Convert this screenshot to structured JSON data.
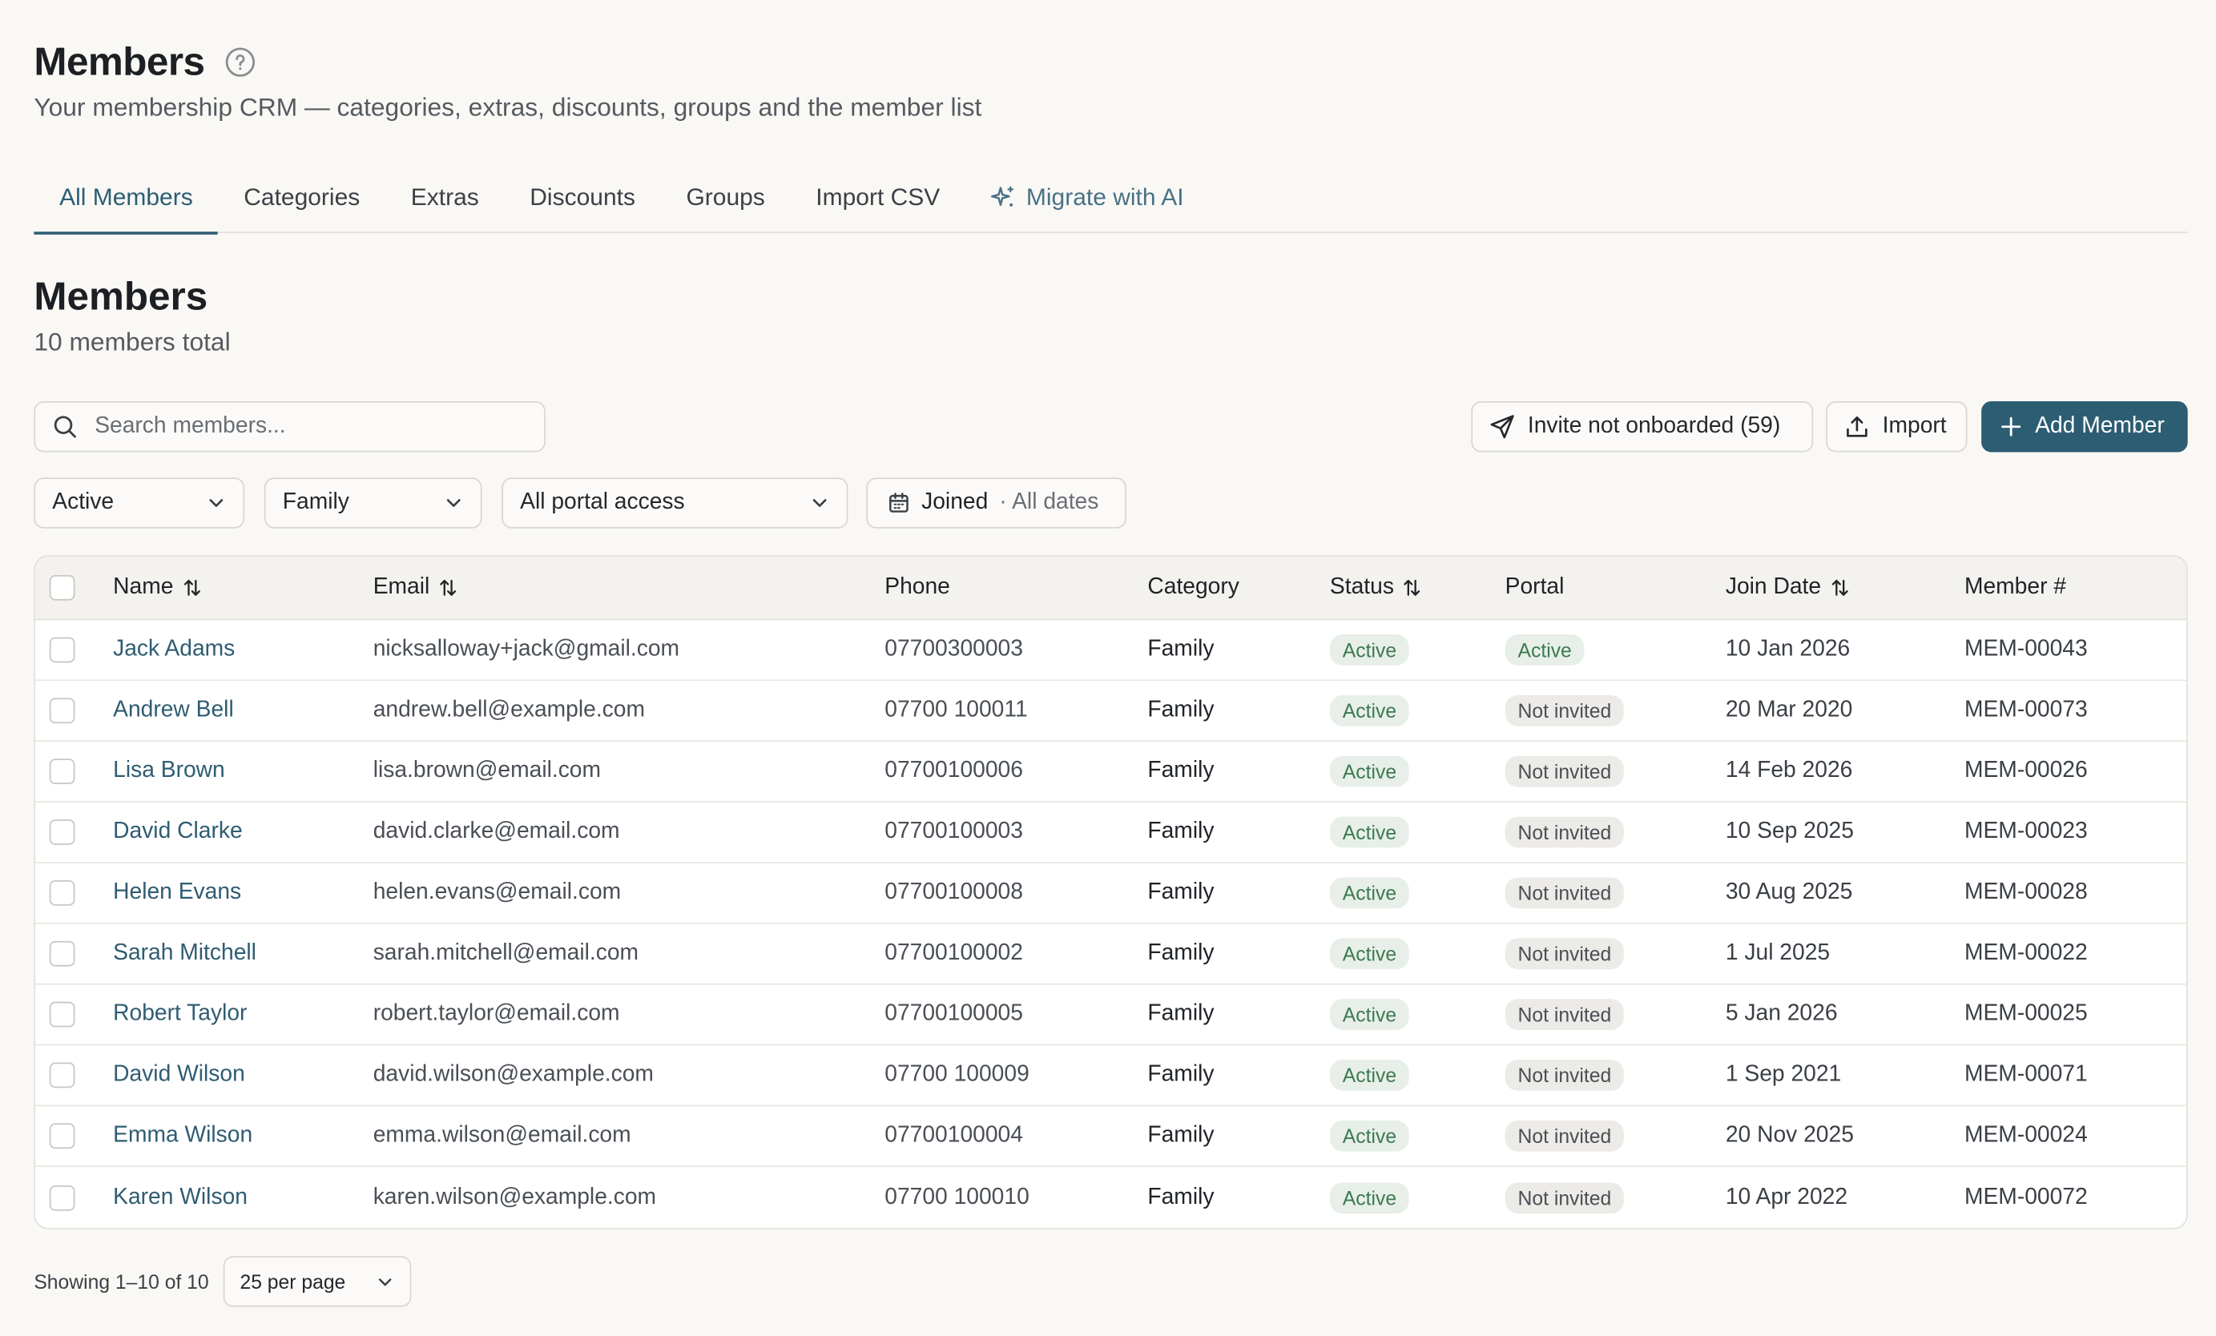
{
  "header": {
    "title": "Members",
    "subtitle": "Your membership CRM — categories, extras, discounts, groups and the member list"
  },
  "tabs": [
    {
      "label": "All Members",
      "active": true
    },
    {
      "label": "Categories"
    },
    {
      "label": "Extras"
    },
    {
      "label": "Discounts"
    },
    {
      "label": "Groups"
    },
    {
      "label": "Import CSV"
    },
    {
      "label": "Migrate with AI",
      "icon": "sparkles-icon"
    }
  ],
  "section": {
    "title": "Members",
    "count_text": "10 members total"
  },
  "search": {
    "placeholder": "Search members...",
    "value": ""
  },
  "actions": {
    "invite_label": "Invite not onboarded (59)",
    "import_label": "Import",
    "add_label": "Add Member"
  },
  "filters": {
    "status": "Active",
    "category": "Family",
    "portal": "All portal access",
    "date_label": "Joined",
    "date_value": "· All dates"
  },
  "table": {
    "headers": {
      "name": "Name",
      "email": "Email",
      "phone": "Phone",
      "category": "Category",
      "status": "Status",
      "portal": "Portal",
      "join_date": "Join Date",
      "member_no": "Member #"
    },
    "rows": [
      {
        "name": "Jack Adams",
        "email": "nicksalloway+jack@gmail.com",
        "phone": "07700300003",
        "category": "Family",
        "status": "Active",
        "portal": "Active",
        "join_date": "10 Jan 2026",
        "member_no": "MEM-00043"
      },
      {
        "name": "Andrew Bell",
        "email": "andrew.bell@example.com",
        "phone": "07700 100011",
        "category": "Family",
        "status": "Active",
        "portal": "Not invited",
        "join_date": "20 Mar 2020",
        "member_no": "MEM-00073"
      },
      {
        "name": "Lisa Brown",
        "email": "lisa.brown@email.com",
        "phone": "07700100006",
        "category": "Family",
        "status": "Active",
        "portal": "Not invited",
        "join_date": "14 Feb 2026",
        "member_no": "MEM-00026"
      },
      {
        "name": "David Clarke",
        "email": "david.clarke@email.com",
        "phone": "07700100003",
        "category": "Family",
        "status": "Active",
        "portal": "Not invited",
        "join_date": "10 Sep 2025",
        "member_no": "MEM-00023"
      },
      {
        "name": "Helen Evans",
        "email": "helen.evans@email.com",
        "phone": "07700100008",
        "category": "Family",
        "status": "Active",
        "portal": "Not invited",
        "join_date": "30 Aug 2025",
        "member_no": "MEM-00028"
      },
      {
        "name": "Sarah Mitchell",
        "email": "sarah.mitchell@email.com",
        "phone": "07700100002",
        "category": "Family",
        "status": "Active",
        "portal": "Not invited",
        "join_date": "1 Jul 2025",
        "member_no": "MEM-00022"
      },
      {
        "name": "Robert Taylor",
        "email": "robert.taylor@email.com",
        "phone": "07700100005",
        "category": "Family",
        "status": "Active",
        "portal": "Not invited",
        "join_date": "5 Jan 2026",
        "member_no": "MEM-00025"
      },
      {
        "name": "David Wilson",
        "email": "david.wilson@example.com",
        "phone": "07700 100009",
        "category": "Family",
        "status": "Active",
        "portal": "Not invited",
        "join_date": "1 Sep 2021",
        "member_no": "MEM-00071"
      },
      {
        "name": "Emma Wilson",
        "email": "emma.wilson@email.com",
        "phone": "07700100004",
        "category": "Family",
        "status": "Active",
        "portal": "Not invited",
        "join_date": "20 Nov 2025",
        "member_no": "MEM-00024"
      },
      {
        "name": "Karen Wilson",
        "email": "karen.wilson@example.com",
        "phone": "07700 100010",
        "category": "Family",
        "status": "Active",
        "portal": "Not invited",
        "join_date": "10 Apr 2022",
        "member_no": "MEM-00072"
      }
    ]
  },
  "pagination": {
    "showing": "Showing 1–10 of 10",
    "per_page": "25 per page"
  },
  "colors": {
    "accent": "#2c5d73",
    "active_badge_bg": "#e8efe9",
    "active_badge_text": "#3d7a52",
    "neutral_badge_bg": "#ecebe7",
    "background": "#f9f8f5"
  }
}
